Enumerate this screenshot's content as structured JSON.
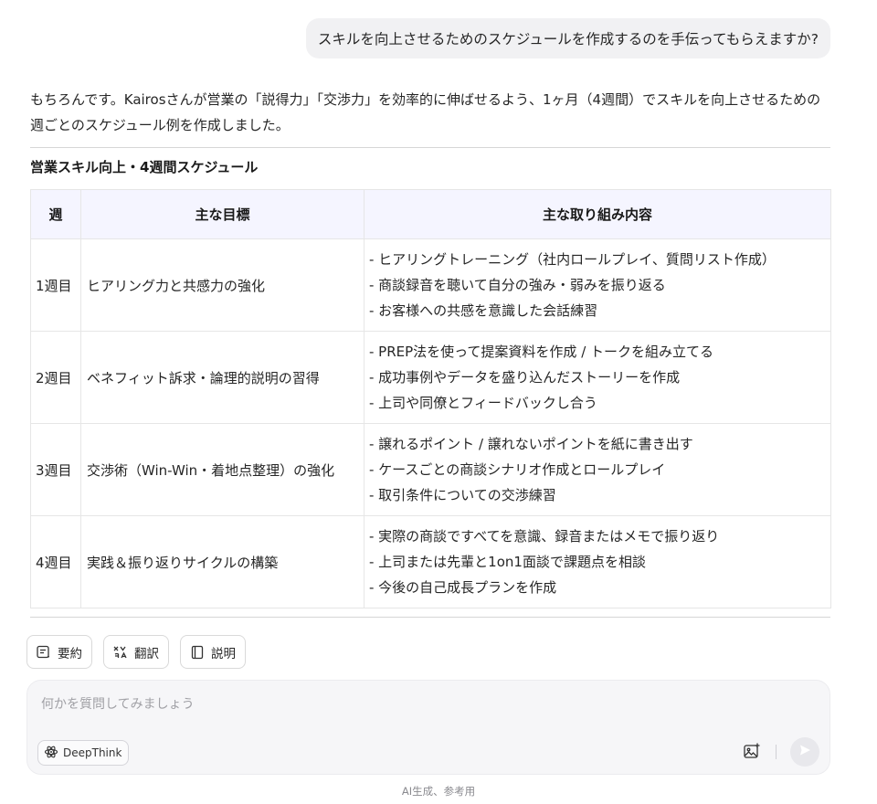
{
  "user_message": "スキルを向上させるためのスケジュールを作成するのを手伝ってもらえますか?",
  "answer": {
    "intro": "もちろんです。Kairosさんが営業の「説得力」「交渉力」を効率的に伸ばせるよう、1ヶ月（4週間）でスキルを向上させるための週ごとのスケジュール例を作成しました。",
    "table_title": "営業スキル向上・4週間スケジュール",
    "table": {
      "headers": [
        "週",
        "主な目標",
        "主な取り組み内容"
      ],
      "rows": [
        {
          "week": "1週目",
          "goal": "ヒアリング力と共感力の強化",
          "activities": [
            "- ヒアリングトレーニング（社内ロールプレイ、質問リスト作成）",
            "- 商談録音を聴いて自分の強み・弱みを振り返る",
            "- お客様への共感を意識した会話練習"
          ]
        },
        {
          "week": "2週目",
          "goal": "ベネフィット訴求・論理的説明の習得",
          "activities": [
            "- PREP法を使って提案資料を作成 / トークを組み立てる",
            "- 成功事例やデータを盛り込んだストーリーを作成",
            "- 上司や同僚とフィードバックし合う"
          ]
        },
        {
          "week": "3週目",
          "goal": "交渉術（Win-Win・着地点整理）の強化",
          "activities": [
            "- 譲れるポイント / 譲れないポイントを紙に書き出す",
            "- ケースごとの商談シナリオ作成とロールプレイ",
            "- 取引条件についての交渉練習"
          ]
        },
        {
          "week": "4週目",
          "goal": "実践＆振り返りサイクルの構築",
          "activities": [
            "- 実際の商談ですべてを意識、録音またはメモで振り返り",
            "- 上司または先輩と1on1面談で課題点を相談",
            "- 今後の自己成長プランを作成"
          ]
        }
      ]
    }
  },
  "actions": [
    {
      "label": "要約",
      "icon": "summary-icon"
    },
    {
      "label": "翻訳",
      "icon": "translate-icon"
    },
    {
      "label": "説明",
      "icon": "book-icon"
    }
  ],
  "composer": {
    "placeholder": "何かを質問してみましょう",
    "deepthink_label": "DeepThink"
  },
  "footer": "AI生成、参考用"
}
